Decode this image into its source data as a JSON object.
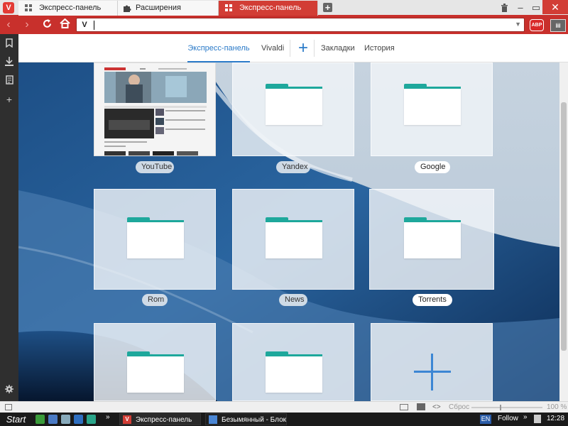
{
  "tabs": [
    {
      "label": "Экспресс-панель",
      "icon": "grid-icon"
    },
    {
      "label": "Расширения",
      "icon": "puzzle-icon"
    },
    {
      "label": "Экспресс-панель",
      "icon": "grid-icon",
      "active": true
    }
  ],
  "address": {
    "value": "",
    "placeholder": ""
  },
  "extensions": {
    "abp": "ABP"
  },
  "speeddial_nav": {
    "express": "Экспресс-панель",
    "vivaldi": "Vivaldi",
    "add": "+",
    "bookmarks": "Закладки",
    "history": "История"
  },
  "tiles": [
    {
      "label": "YouTube",
      "type": "thumbnail"
    },
    {
      "label": "Yandex",
      "type": "folder"
    },
    {
      "label": "Google",
      "type": "folder"
    },
    {
      "label": "Rom",
      "type": "folder"
    },
    {
      "label": "News",
      "type": "folder"
    },
    {
      "label": "Torrents",
      "type": "folder"
    },
    {
      "label": "",
      "type": "folder"
    },
    {
      "label": "",
      "type": "folder"
    },
    {
      "label": "",
      "type": "add"
    }
  ],
  "statusbar": {
    "reset": "Сброс",
    "zoom": "100 %"
  },
  "taskbar": {
    "start": "Start",
    "items": [
      {
        "label": "Экспресс-панель"
      },
      {
        "label": "Безымянный - Блок..."
      }
    ],
    "lang": "EN",
    "follow": "Follow",
    "clock": "12:28"
  },
  "colors": {
    "accent": "#c8302c",
    "link": "#2a7ac8",
    "folder": "#1ea89c"
  }
}
